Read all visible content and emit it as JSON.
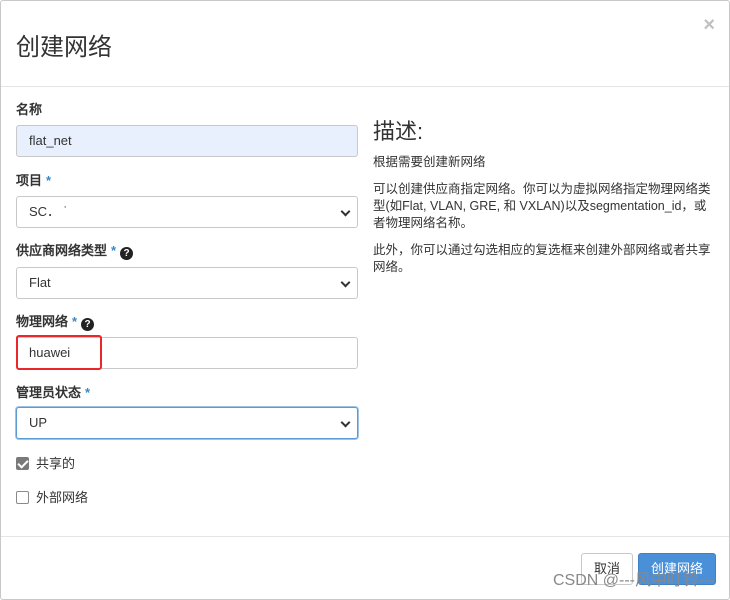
{
  "dialog": {
    "title": "创建网络",
    "close_label": "×"
  },
  "form": {
    "name": {
      "label": "名称",
      "value": "flat_net"
    },
    "project": {
      "label": "项目",
      "required": "*",
      "value": "SC．  ˙"
    },
    "provider_network_type": {
      "label": "供应商网络类型",
      "required": "*",
      "help": "?",
      "value": "Flat"
    },
    "physical_network": {
      "label": "物理网络",
      "required": "*",
      "help": "?",
      "value": "huawei"
    },
    "admin_state": {
      "label": "管理员状态",
      "required": "*",
      "value": "UP"
    },
    "shared": {
      "label": "共享的",
      "checked": true
    },
    "external": {
      "label": "外部网络",
      "checked": false
    }
  },
  "description": {
    "title": "描述:",
    "p1": "根据需要创建新网络",
    "p2": "可以创建供应商指定网络。你可以为虚拟网络指定物理网络类型(如Flat, VLAN, GRE, 和 VXLAN)以及segmentation_id，或者物理网络名称。",
    "p3": "此外，你可以通过勾选相应的复选框来创建外部网络或者共享网络。"
  },
  "footer": {
    "cancel_label": "取消",
    "submit_label": "创建网络"
  },
  "watermark": "CSDN @---风中叮铃---",
  "colors": {
    "primary": "#4a90d9",
    "required_star": "#3a87c8",
    "highlight": "#e8282b",
    "autofill_bg": "#e8f0fe"
  }
}
